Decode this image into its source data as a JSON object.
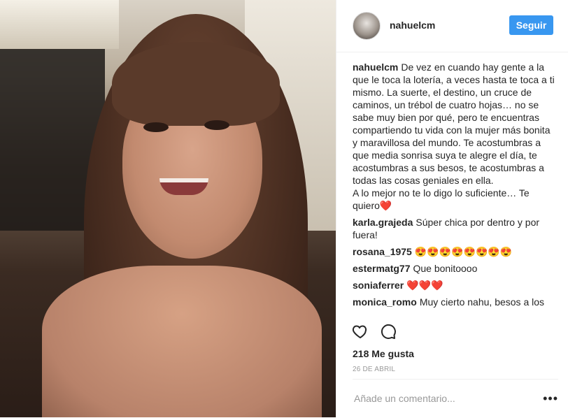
{
  "post": {
    "username": "nahuelcm",
    "follow_label": "Seguir",
    "caption_user": "nahuelcm",
    "caption": "De vez en cuando hay gente a la que le toca la lotería, a veces hasta te toca a ti mismo. La suerte, el destino, un cruce de caminos, un trébol de cuatro hojas… no se sabe muy bien por qué, pero te encuentras compartiendo tu vida con la mujer más bonita y maravillosa del mundo. Te acostumbras a que media sonrisa suya te alegre el día, te acostumbras a sus besos, te acostumbras a todas las cosas geniales en ella.\nA lo mejor no te lo digo lo suficiente… Te quiero",
    "caption_end": "❤️"
  },
  "comments": [
    {
      "user": "karla.grajeda",
      "text": "Súper chica por dentro y por fuera!"
    },
    {
      "user": "rosana_1975",
      "text": "😍😍😍😍😍😍😍😍"
    },
    {
      "user": "estermatg77",
      "text": "Que bonitoooo"
    },
    {
      "user": "soniaferrer",
      "text": "❤️❤️❤️"
    },
    {
      "user": "monica_romo",
      "text": "Muy cierto nahu, besos a los"
    }
  ],
  "footer": {
    "likes": "218 Me gusta",
    "date": "26 DE ABRIL",
    "comment_placeholder": "Añade un comentario...",
    "more": "•••"
  },
  "icons": {
    "like": "heart-outline-icon",
    "comment": "speech-bubble-icon",
    "more": "more-options-icon"
  }
}
